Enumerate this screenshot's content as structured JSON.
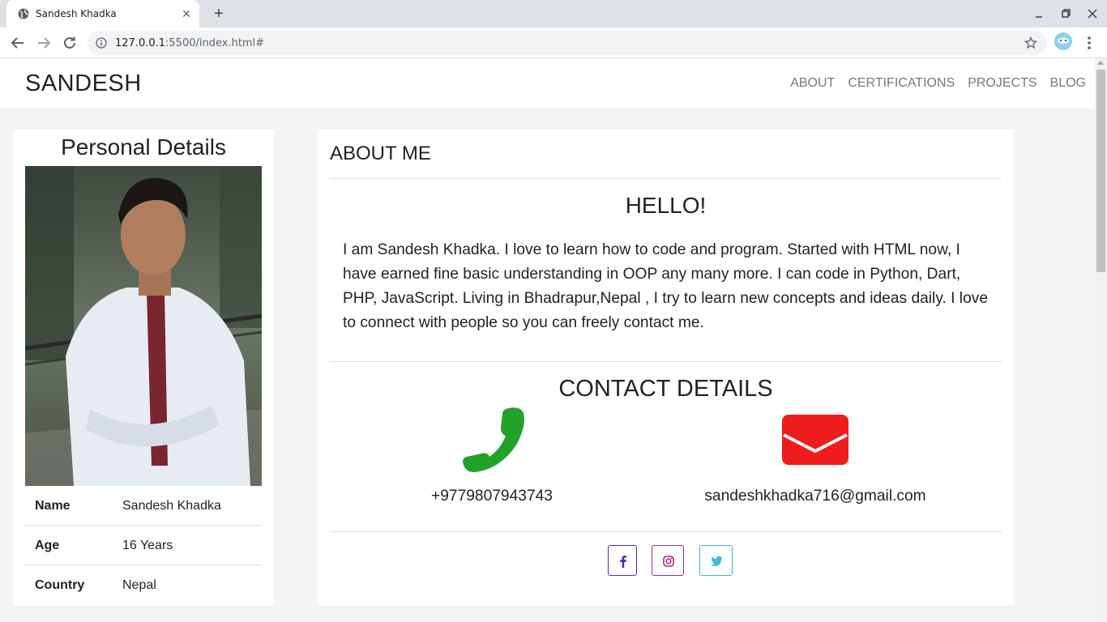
{
  "browser": {
    "tab_title": "Sandesh Khadka",
    "url_host": "127.0.0.1",
    "url_rest": ":5500/index.html#"
  },
  "header": {
    "brand": "SANDESH",
    "nav": [
      "ABOUT",
      "CERTIFICATIONS",
      "PROJECTS",
      "BLOG"
    ]
  },
  "personal": {
    "title": "Personal Details",
    "rows": [
      {
        "label": "Name",
        "value": "Sandesh Khadka"
      },
      {
        "label": "Age",
        "value": "16 Years"
      },
      {
        "label": "Country",
        "value": "Nepal"
      }
    ]
  },
  "about": {
    "title": "ABOUT ME",
    "greeting": "HELLO!",
    "bio": "I am Sandesh Khadka. I love to learn how to code and program. Started with HTML now, I have earned fine basic understanding in OOP any many more. I can code in Python, Dart, PHP, JavaScript. Living in Bhadrapur,Nepal , I try to learn new concepts and ideas daily. I love to connect with people so you can freely contact me."
  },
  "contact": {
    "title": "CONTACT DETAILS",
    "phone": "+9779807943743",
    "email": "sandeshkhadka716@gmail.com",
    "phone_color": "#22a12b",
    "email_color": "#ee1c1c"
  },
  "social": [
    {
      "icon": "facebook-icon",
      "color": "#3b33b3"
    },
    {
      "icon": "instagram-icon",
      "color": "#b1237f"
    },
    {
      "icon": "twitter-icon",
      "color": "#3cb8d0"
    }
  ]
}
